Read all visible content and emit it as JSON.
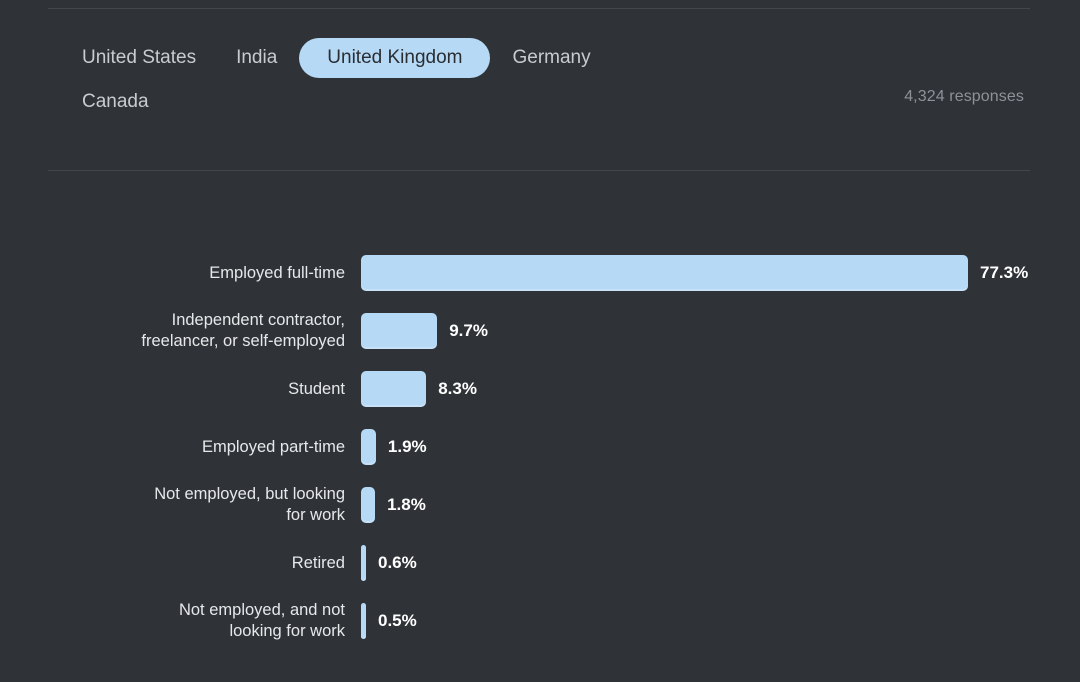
{
  "header": {
    "country_tabs": [
      {
        "label": "United States",
        "selected": false
      },
      {
        "label": "India",
        "selected": false
      },
      {
        "label": "United Kingdom",
        "selected": true
      },
      {
        "label": "Germany",
        "selected": false
      },
      {
        "label": "Canada",
        "selected": false
      }
    ],
    "responses_text": "4,324 responses"
  },
  "colors": {
    "background": "#2f3337",
    "bar": "#b6d9f6",
    "selected_tab_bg": "#b6d9f6",
    "selected_tab_text": "#2a2e33",
    "tab_text": "#c8ccd1",
    "label_text": "#e6e8ea",
    "value_text": "#ffffff",
    "muted_text": "#8d9299",
    "divider": "#43474c"
  },
  "chart_data": {
    "type": "bar",
    "orientation": "horizontal",
    "title": "",
    "subtitle": "",
    "xlabel": "",
    "ylabel": "",
    "xlim": [
      0,
      100
    ],
    "grid": false,
    "legend": "none",
    "unit": "%",
    "total_responses": 4324,
    "categories": [
      "Employed full-time",
      "Independent contractor,\nfreelancer, or self-employed",
      "Student",
      "Employed part-time",
      "Not employed, but looking\nfor work",
      "Retired",
      "Not employed, and not\nlooking for work"
    ],
    "values": [
      77.3,
      9.7,
      8.3,
      1.9,
      1.8,
      0.6,
      0.5
    ],
    "value_labels": [
      "77.3%",
      "9.7%",
      "8.3%",
      "1.9%",
      "1.8%",
      "0.6%",
      "0.5%"
    ]
  }
}
